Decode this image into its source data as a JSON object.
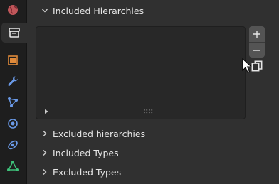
{
  "sidebar": {
    "tabs": [
      {
        "icon": "world-icon"
      },
      {
        "icon": "collection-icon",
        "active": true
      },
      {
        "icon": "object-icon"
      },
      {
        "icon": "wrench-icon"
      },
      {
        "icon": "particles-icon"
      },
      {
        "icon": "physics-icon"
      },
      {
        "icon": "constraints-icon"
      },
      {
        "icon": "object-data-icon"
      }
    ]
  },
  "panels": {
    "included_hierarchies": {
      "label": "Included Hierarchies",
      "expanded": true
    },
    "excluded_hierarchies": {
      "label": "Excluded hierarchies",
      "expanded": false
    },
    "included_types": {
      "label": "Included Types",
      "expanded": false
    },
    "excluded_types": {
      "label": "Excluded Types",
      "expanded": false
    }
  },
  "list_buttons": {
    "add": {
      "icon": "plus-icon"
    },
    "remove": {
      "icon": "minus-icon"
    },
    "copy": {
      "icon": "copy-icon"
    }
  },
  "colors": {
    "background": "#303030",
    "sidebar": "#1e1e1e",
    "list_box": "#282828",
    "button": "#545454",
    "text": "#e6e6e6"
  }
}
